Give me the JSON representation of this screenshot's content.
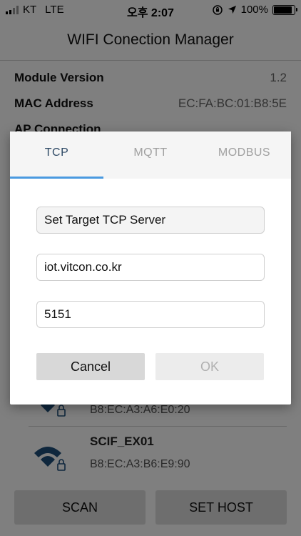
{
  "status": {
    "carrier": "KT",
    "network": "LTE",
    "time": "오후 2:07",
    "battery_percent": "100%",
    "battery_level": 1.0
  },
  "header": {
    "title": "WIFI Conection Manager"
  },
  "info": [
    {
      "label": "Module Version",
      "value": "1.2"
    },
    {
      "label": "MAC Address",
      "value": "EC:FA:BC:01:B8:5E"
    },
    {
      "label": "AP Connection",
      "value": ""
    }
  ],
  "networks": [
    {
      "name": "",
      "mac": "B8:EC:A3:A6:E0:20"
    },
    {
      "name": "SCIF_EX01",
      "mac": "B8:EC:A3:B6:E9:90"
    }
  ],
  "buttons": {
    "scan": "SCAN",
    "set_host": "SET HOST"
  },
  "dialog": {
    "tabs": [
      "TCP",
      "MQTT",
      "MODBUS"
    ],
    "active_tab": "TCP",
    "fields": [
      {
        "value": "Set Target TCP Server"
      },
      {
        "value": "iot.vitcon.co.kr"
      },
      {
        "value": "5151"
      }
    ],
    "cancel_label": "Cancel",
    "ok_label": "OK"
  },
  "colors": {
    "accent": "#4a9ae0",
    "wifi_icon": "#1e4f7a",
    "active_tab_text": "#2f4a66",
    "inactive_tab_text": "#a0a0a0"
  }
}
